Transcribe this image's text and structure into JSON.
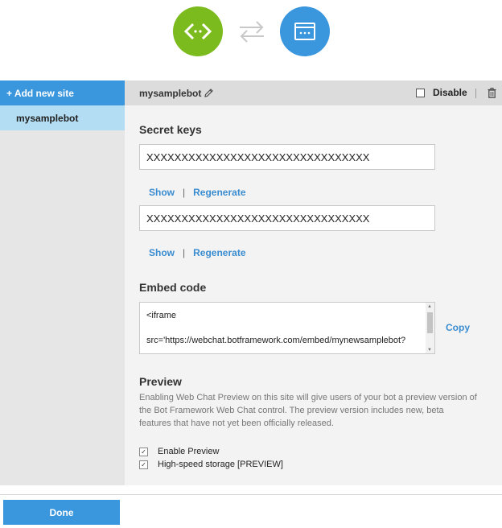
{
  "header": {
    "bot_icon": "code-brackets-icon",
    "swap_icon": "swap-arrows-icon",
    "web_icon": "browser-window-icon"
  },
  "sidebar": {
    "add_label": "+ Add new site",
    "items": [
      {
        "label": "mysamplebot"
      }
    ]
  },
  "site": {
    "name": "mysamplebot",
    "disable_label": "Disable"
  },
  "secret_keys": {
    "title": "Secret keys",
    "keys": [
      {
        "value": "XXXXXXXXXXXXXXXXXXXXXXXXXXXXXXXX",
        "show_label": "Show",
        "separator": "|",
        "regenerate_label": "Regenerate"
      },
      {
        "value": "XXXXXXXXXXXXXXXXXXXXXXXXXXXXXXXX",
        "show_label": "Show",
        "separator": "|",
        "regenerate_label": "Regenerate"
      }
    ]
  },
  "embed": {
    "title": "Embed code",
    "line1": "<iframe",
    "line2": "src='https://webchat.botframework.com/embed/mynewsamplebot?",
    "copy_label": "Copy"
  },
  "preview": {
    "title": "Preview",
    "description": "Enabling Web Chat Preview on this site will give users of your bot a preview version of the Bot Framework Web Chat control. The preview version includes new, beta features that have not yet been officially released.",
    "options": [
      {
        "label": "Enable Preview",
        "checked": true
      },
      {
        "label": "High-speed storage [PREVIEW]",
        "checked": true
      }
    ]
  },
  "footer": {
    "done_label": "Done"
  },
  "colors": {
    "accent": "#3a96dd",
    "bot_green": "#7cbb1e",
    "link": "#3a8cd0"
  }
}
